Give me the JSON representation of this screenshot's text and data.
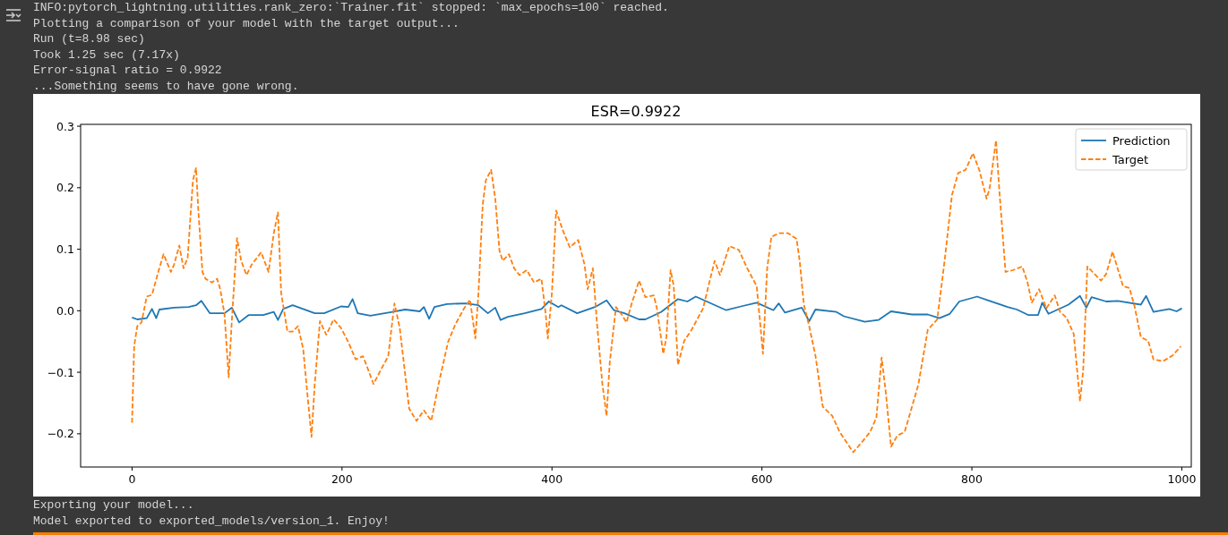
{
  "output": {
    "lines_before": [
      "INFO:pytorch_lightning.utilities.rank_zero:`Trainer.fit` stopped: `max_epochs=100` reached.",
      "Plotting a comparison of your model with the target output...",
      "Run (t=8.98 sec)",
      "Took 1.25 sec (7.17x)",
      "Error-signal ratio = 0.9922",
      "...Something seems to have gone wrong."
    ],
    "figure": {
      "chart_data": {
        "type": "line",
        "title": "ESR=0.9922",
        "legend": true,
        "xlim": [
          -49,
          1009
        ],
        "ylim": [
          -0.254,
          0.303
        ],
        "xticks": [
          0,
          200,
          400,
          600,
          800,
          1000
        ],
        "yticks": [
          {
            "value": -0.2,
            "label": "−0.2"
          },
          {
            "value": -0.1,
            "label": "−0.1"
          },
          {
            "value": 0,
            "label": "0.0"
          },
          {
            "value": 0.1,
            "label": "0.1"
          },
          {
            "value": 0.2,
            "label": "0.2"
          },
          {
            "value": 0.3,
            "label": "0.3"
          }
        ],
        "series": [
          {
            "name": "Prediction",
            "color": "#1f77b4",
            "line_style": "solid",
            "x": [
              0,
              5,
              14,
              19,
              23,
              26,
              40,
              54,
              61,
              66,
              74,
              88,
              95,
              102,
              111,
              125,
              135,
              139,
              144,
              153,
              174,
              183,
              199,
              206,
              210,
              215,
              227,
              248,
              260,
              274,
              278,
              283,
              288,
              300,
              318,
              330,
              339,
              346,
              351,
              358,
              374,
              390,
              397,
              406,
              409,
              424,
              441,
              452,
              459,
              469,
              483,
              489,
              504,
              520,
              529,
              537,
              566,
              580,
              595,
              611,
              616,
              622,
              638,
              645,
              651,
              671,
              678,
              698,
              711,
              723,
              743,
              758,
              769,
              779,
              788,
              805,
              817,
              834,
              843,
              854,
              863,
              867,
              873,
              892,
              903,
              909,
              914,
              928,
              939,
              961,
              966,
              973,
              988,
              995,
              1000
            ],
            "values": [
              -0.011,
              -0.014,
              -0.012,
              0.003,
              -0.012,
              0.002,
              0.005,
              0.006,
              0.009,
              0.016,
              -0.004,
              -0.004,
              0.005,
              -0.019,
              -0.007,
              -0.007,
              -0.002,
              -0.015,
              0.003,
              0.009,
              -0.004,
              -0.004,
              0.007,
              0.006,
              0.019,
              -0.004,
              -0.008,
              -0.002,
              0.002,
              -0.001,
              0.006,
              -0.013,
              0.006,
              0.011,
              0.012,
              0.009,
              -0.004,
              0.005,
              -0.015,
              -0.01,
              -0.004,
              0.003,
              0.015,
              0.006,
              0.009,
              -0.004,
              0.006,
              0.017,
              0.001,
              -0.004,
              -0.014,
              -0.014,
              -0.002,
              0.019,
              0.015,
              0.023,
              0.001,
              0.007,
              0.013,
              0.001,
              0.012,
              -0.003,
              0.005,
              -0.017,
              0.002,
              -0.002,
              -0.009,
              -0.018,
              -0.015,
              -0.001,
              -0.006,
              -0.006,
              -0.012,
              -0.005,
              0.015,
              0.023,
              0.016,
              0.006,
              0.002,
              -0.007,
              -0.007,
              0.013,
              -0.005,
              0.01,
              0.024,
              0.005,
              0.022,
              0.015,
              0.016,
              0.01,
              0.024,
              -0.002,
              0.003,
              -0.001,
              0.004
            ]
          },
          {
            "name": "Target",
            "color": "#ff7f0e",
            "line_style": "dashed",
            "x": [
              0,
              2,
              5,
              9,
              14,
              19,
              25,
              30,
              37,
              40,
              45,
              49,
              53,
              58,
              61,
              63,
              67,
              70,
              76,
              81,
              84,
              88,
              92,
              95,
              100,
              104,
              109,
              114,
              123,
              130,
              135,
              139,
              142,
              148,
              153,
              158,
              163,
              167,
              171,
              174,
              179,
              185,
              192,
              199,
              206,
              213,
              220,
              225,
              230,
              237,
              244,
              250,
              255,
              264,
              271,
              278,
              285,
              292,
              301,
              308,
              316,
              322,
              327,
              330,
              334,
              337,
              342,
              346,
              350,
              353,
              359,
              364,
              369,
              376,
              383,
              390,
              394,
              396,
              400,
              404,
              410,
              417,
              425,
              431,
              434,
              439,
              443,
              448,
              452,
              455,
              461,
              466,
              471,
              476,
              483,
              489,
              497,
              500,
              506,
              509,
              513,
              516,
              520,
              526,
              533,
              544,
              549,
              555,
              560,
              569,
              578,
              586,
              595,
              598,
              601,
              605,
              609,
              616,
              625,
              633,
              636,
              640,
              645,
              651,
              658,
              667,
              674,
              687,
              696,
              703,
              709,
              714,
              718,
              723,
              729,
              736,
              743,
              749,
              758,
              767,
              774,
              781,
              787,
              794,
              801,
              807,
              814,
              817,
              823,
              826,
              832,
              839,
              848,
              853,
              857,
              864,
              871,
              879,
              884,
              890,
              897,
              903,
              906,
              910,
              915,
              923,
              928,
              934,
              944,
              950,
              955,
              961,
              968,
              973,
              982,
              991,
              999
            ],
            "values": [
              -0.182,
              -0.057,
              -0.025,
              -0.019,
              0.023,
              0.026,
              0.063,
              0.092,
              0.063,
              0.075,
              0.106,
              0.069,
              0.086,
              0.212,
              0.232,
              0.166,
              0.063,
              0.052,
              0.046,
              0.052,
              0.035,
              -0.005,
              -0.108,
              -0.017,
              0.118,
              0.081,
              0.058,
              0.075,
              0.095,
              0.063,
              0.126,
              0.16,
              0.029,
              -0.034,
              -0.034,
              -0.025,
              -0.062,
              -0.136,
              -0.205,
              -0.119,
              -0.017,
              -0.039,
              -0.014,
              -0.028,
              -0.051,
              -0.079,
              -0.074,
              -0.096,
              -0.119,
              -0.096,
              -0.074,
              0.012,
              -0.028,
              -0.159,
              -0.179,
              -0.162,
              -0.179,
              -0.119,
              -0.051,
              -0.022,
              0.003,
              0.018,
              -0.045,
              0.029,
              0.172,
              0.212,
              0.229,
              0.183,
              0.098,
              0.081,
              0.092,
              0.069,
              0.058,
              0.066,
              0.046,
              0.052,
              -0.005,
              -0.045,
              0.029,
              0.163,
              0.132,
              0.103,
              0.115,
              0.075,
              0.035,
              0.069,
              -0.022,
              -0.119,
              -0.171,
              -0.085,
              0.006,
              -0.005,
              -0.019,
              0.012,
              0.049,
              0.022,
              0.025,
              0.004,
              -0.07,
              -0.043,
              0.066,
              0.04,
              -0.088,
              -0.049,
              -0.031,
              0.004,
              0.04,
              0.081,
              0.058,
              0.105,
              0.099,
              0.069,
              0.04,
              -0.014,
              -0.07,
              0.069,
              0.12,
              0.126,
              0.126,
              0.117,
              0.081,
              0.01,
              -0.025,
              -0.073,
              -0.156,
              -0.171,
              -0.197,
              -0.23,
              -0.212,
              -0.197,
              -0.174,
              -0.076,
              -0.132,
              -0.221,
              -0.203,
              -0.197,
              -0.156,
              -0.12,
              -0.031,
              -0.014,
              0.081,
              0.188,
              0.224,
              0.229,
              0.256,
              0.229,
              0.182,
              0.2,
              0.277,
              0.2,
              0.063,
              0.066,
              0.072,
              0.046,
              0.013,
              0.035,
              0.004,
              0.025,
              -0.002,
              -0.011,
              -0.037,
              -0.147,
              -0.097,
              0.072,
              0.063,
              0.049,
              0.06,
              0.096,
              0.04,
              0.037,
              0.007,
              -0.043,
              -0.049,
              -0.079,
              -0.082,
              -0.073,
              -0.058
            ]
          }
        ]
      }
    },
    "lines_after": [
      "Exporting your model...",
      "Model exported to exported_models/version_1. Enjoy!"
    ]
  }
}
